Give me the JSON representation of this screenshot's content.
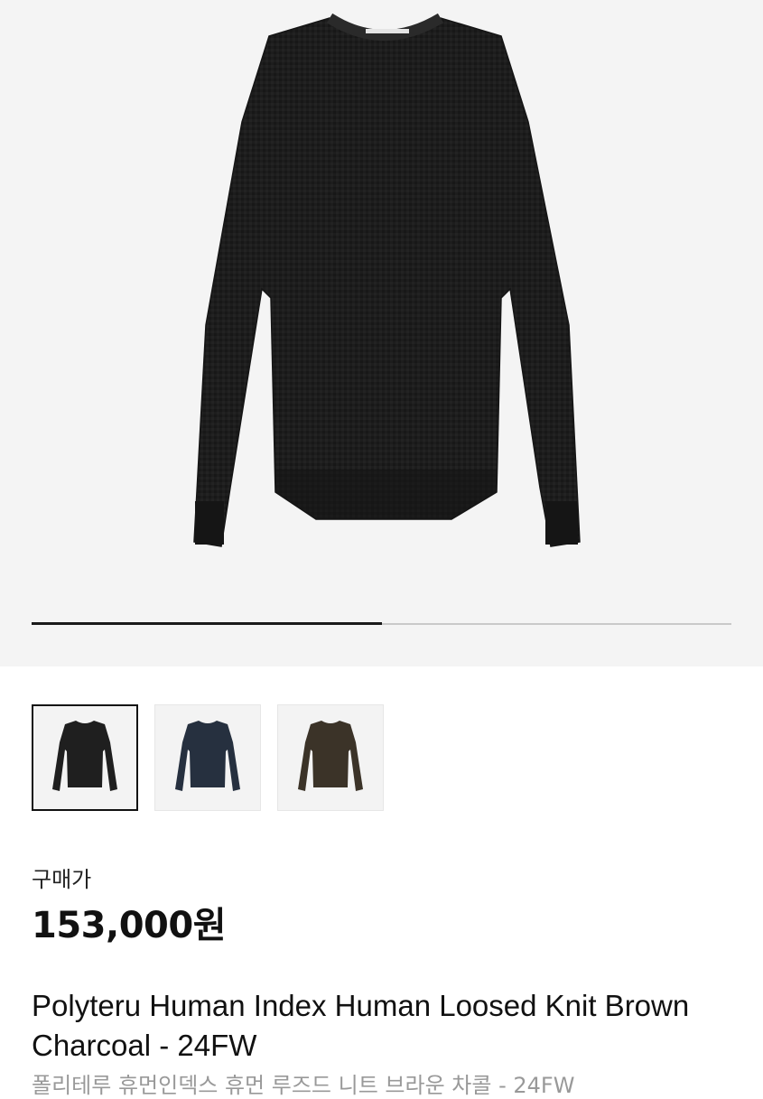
{
  "gallery": {
    "progress_fraction": 0.5,
    "main_image": "black-knit-sweater",
    "thumbnails": [
      {
        "name": "thumbnail-black",
        "color": "#1f1f1f",
        "selected": true
      },
      {
        "name": "thumbnail-navy",
        "color": "#26303f",
        "selected": false
      },
      {
        "name": "thumbnail-brown-charcoal",
        "color": "#3b3328",
        "selected": false
      }
    ]
  },
  "product": {
    "price_label": "구매가",
    "price": "153,000원",
    "title": "Polyteru Human Index Human Loosed Knit Brown Charcoal - 24FW",
    "subtitle_ko": "폴리테루 휴먼인덱스 휴먼 루즈드 니트 브라운 차콜 - 24FW"
  },
  "colors": {
    "hero_bg": "#f4f4f4",
    "sweater": "#1c1c1c",
    "accent": "#111111"
  }
}
